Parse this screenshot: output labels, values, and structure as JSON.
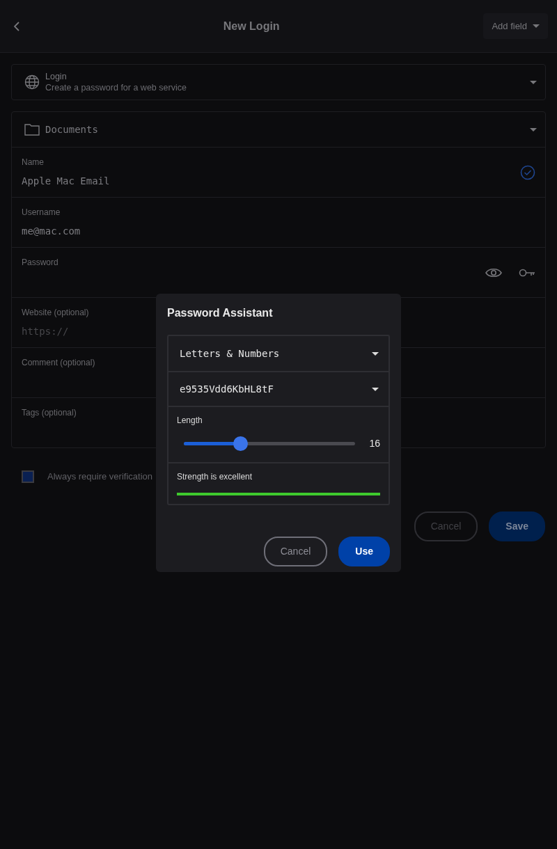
{
  "header": {
    "title": "New Login",
    "add_field": "Add field"
  },
  "type_card": {
    "title": "Login",
    "subtitle": "Create a password for a web service"
  },
  "folder": {
    "name": "Documents"
  },
  "fields": [
    {
      "kind": "text",
      "label": "Name",
      "value": "Apple Mac Email",
      "valid": true
    },
    {
      "kind": "text",
      "label": "Username",
      "value": "me@mac.com",
      "valid": false
    },
    {
      "kind": "password",
      "label": "Password",
      "valid": false
    },
    {
      "kind": "text",
      "label": "Website (optional)",
      "placeholder": "https://",
      "valid": false
    },
    {
      "kind": "text",
      "label": "Comment (optional)",
      "valid": false
    },
    {
      "kind": "text",
      "label": "Tags (optional)",
      "valid": false
    }
  ],
  "verification": {
    "label": "Always require verification",
    "checked": false
  },
  "buttons": [
    {
      "kind": "secondary",
      "label": "Cancel"
    },
    {
      "kind": "primary",
      "label": "Save"
    }
  ],
  "dialog": {
    "title": "Password Assistant",
    "mode": "Letters & Numbers",
    "password": "e9535Vdd6KbHL8tF",
    "length": {
      "label": "Length",
      "level": 0.33,
      "reading": "16"
    },
    "strength": {
      "label": "Strength is excellent",
      "color": "#3ec92d"
    },
    "buttons": [
      {
        "kind": "secondary",
        "label": "Cancel"
      },
      {
        "kind": "primary",
        "label": "Use"
      }
    ]
  }
}
